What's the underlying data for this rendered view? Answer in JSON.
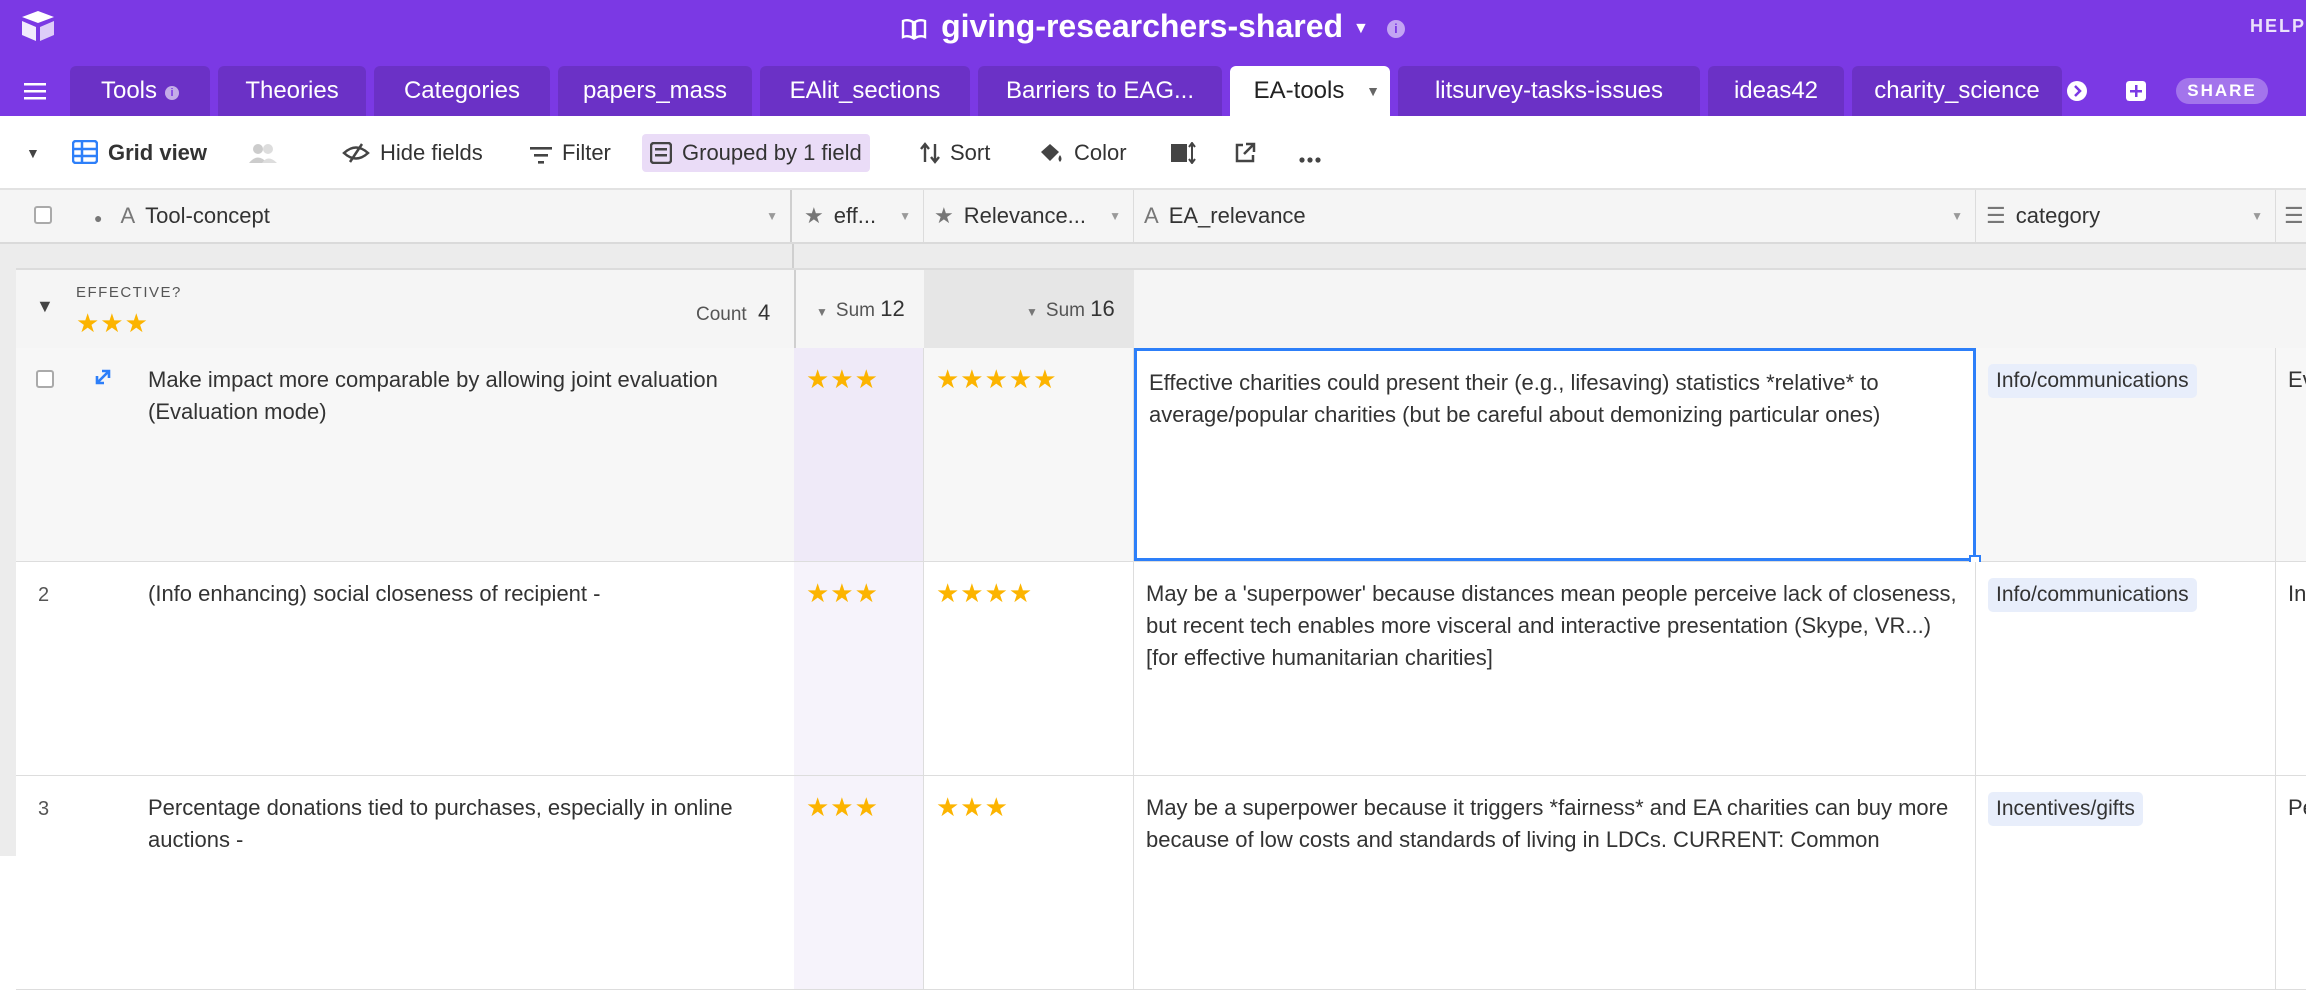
{
  "app": {
    "base_name": "giving-researchers-shared",
    "help": "HELP"
  },
  "tabs": [
    {
      "label": "Tools",
      "has_info": true
    },
    {
      "label": "Theories"
    },
    {
      "label": "Categories"
    },
    {
      "label": "papers_mass"
    },
    {
      "label": "EAlit_sections"
    },
    {
      "label": "Barriers to EAG..."
    },
    {
      "label": "EA-tools",
      "active": true
    },
    {
      "label": "litsurvey-tasks-issues"
    },
    {
      "label": "ideas42"
    },
    {
      "label": "charity_science"
    }
  ],
  "share_label": "SHARE",
  "toolbar": {
    "view_name": "Grid view",
    "hide_fields": "Hide fields",
    "filter": "Filter",
    "grouped": "Grouped by 1 field",
    "sort": "Sort",
    "color": "Color"
  },
  "columns": {
    "tool": "Tool-concept",
    "eff": "eff...",
    "relevance": "Relevance...",
    "ea_relevance": "EA_relevance",
    "category": "category"
  },
  "group": {
    "field_label": "EFFECTIVE?",
    "stars": 3,
    "count_label": "Count",
    "count": "4",
    "sum_label": "Sum",
    "eff_sum": "12",
    "relevance_sum": "16"
  },
  "rows": [
    {
      "num": "",
      "tool": "Make impact more comparable by allowing joint evaluation (Evaluation mode)",
      "eff": 3,
      "relevance": 5,
      "ea_relevance": "Effective charities could present their (e.g., lifesaving) statistics *relative* to average/popular charities (but be careful about demonizing particular ones)",
      "category": "Info/communications",
      "next_col": "Ev"
    },
    {
      "num": "2",
      "tool": "(Info enhancing) social closeness of recipient -",
      "eff": 3,
      "relevance": 4,
      "ea_relevance": "May be a 'superpower' because distances mean people perceive lack of closeness, but recent tech enables more visceral and interactive presentation (Skype, VR...) [for effective humanitarian charities]",
      "category": "Info/communications",
      "next_col": "In"
    },
    {
      "num": "3",
      "tool": "Percentage donations tied to purchases, especially in online auctions -",
      "eff": 3,
      "relevance": 3,
      "ea_relevance": "May be a superpower because it triggers *fairness* and EA charities can buy more because of low costs and standards of living in LDCs.  CURRENT: Common",
      "category": "Incentives/gifts",
      "next_col": "Pe"
    }
  ],
  "colors": {
    "brand": "#7b39e4",
    "star": "#fcb400",
    "selection": "#2d7ff9",
    "tag_bg": "#e8eefb"
  }
}
